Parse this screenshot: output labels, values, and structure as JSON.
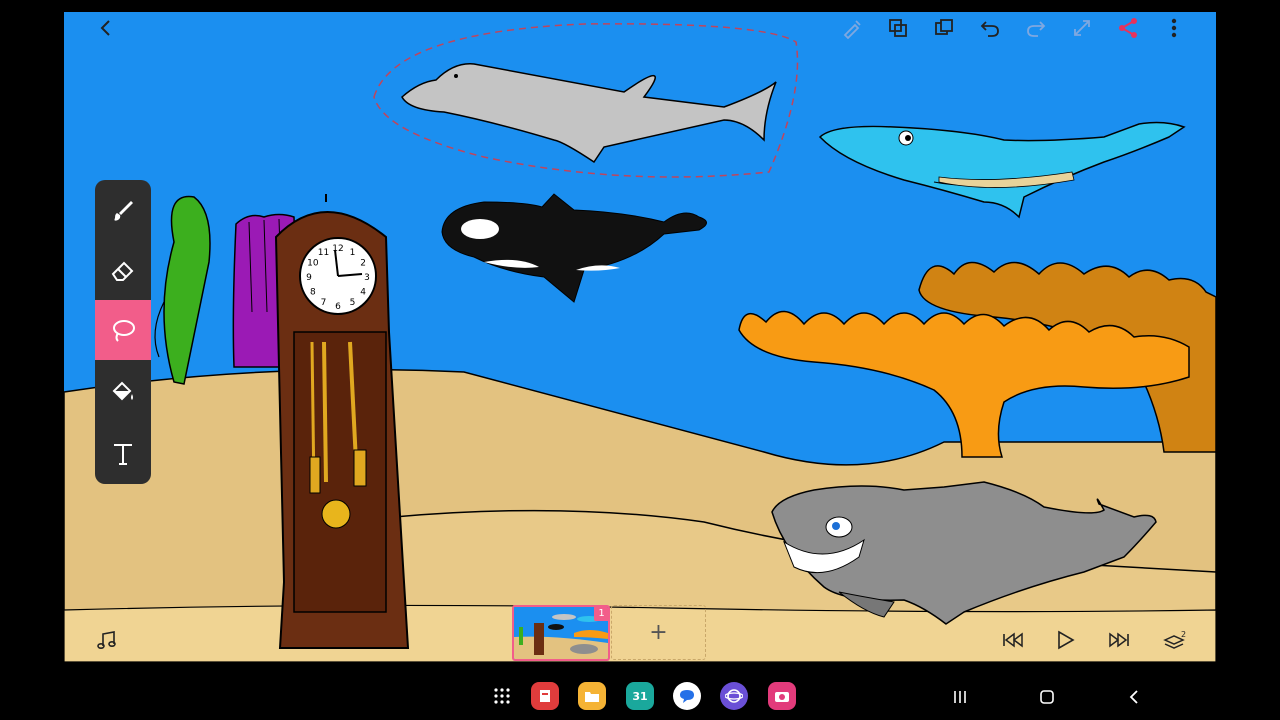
{
  "header": {
    "icons": [
      "back-icon",
      "eyedropper-icon",
      "copy-icon",
      "paste-icon",
      "undo-icon",
      "redo-icon",
      "transform-icon",
      "share-icon",
      "more-icon"
    ],
    "accent": "#f25d8a"
  },
  "tools": [
    {
      "name": "brush-icon"
    },
    {
      "name": "eraser-icon"
    },
    {
      "name": "lasso-icon",
      "active": true
    },
    {
      "name": "fill-bucket-icon"
    },
    {
      "name": "text-icon"
    }
  ],
  "frames": {
    "current_badge": "1",
    "add_label": "+"
  },
  "clock": {
    "numerals": [
      "12",
      "1",
      "2",
      "3",
      "4",
      "5",
      "6",
      "7",
      "8",
      "9",
      "10",
      "11"
    ]
  },
  "taskbar": {
    "calendar_day": "31"
  },
  "colors": {
    "sea": "#1b8ff0",
    "sand": "#e8c988",
    "toolbar": "#2e2e2e",
    "active_tool": "#f25d8a"
  }
}
